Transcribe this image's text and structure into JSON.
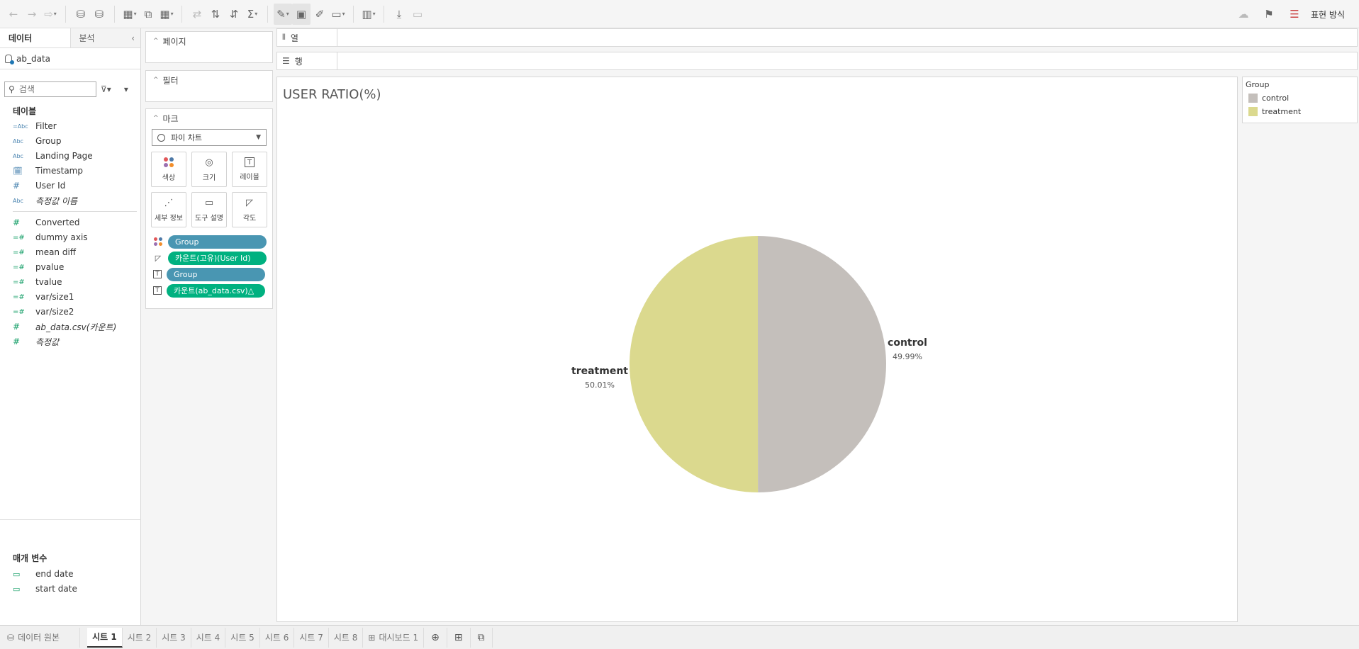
{
  "toolbar": {
    "right_label": "표현 방식"
  },
  "data_pane": {
    "tab_data": "데이터",
    "tab_analysis": "분석",
    "datasource": "ab_data",
    "search_placeholder": "검색",
    "tables_title": "테이블",
    "dimensions": [
      {
        "name": "Filter",
        "type": "abc-calc"
      },
      {
        "name": "Group",
        "type": "abc"
      },
      {
        "name": "Landing Page",
        "type": "abc"
      },
      {
        "name": "Timestamp",
        "type": "datetime"
      },
      {
        "name": "User Id",
        "type": "number"
      },
      {
        "name": "측정값 이름",
        "type": "abc",
        "italic": true
      }
    ],
    "measures": [
      {
        "name": "Converted",
        "type": "number"
      },
      {
        "name": "dummy axis",
        "type": "number-calc"
      },
      {
        "name": "mean diff",
        "type": "number-calc"
      },
      {
        "name": "pvalue",
        "type": "number-calc"
      },
      {
        "name": "tvalue",
        "type": "number-calc"
      },
      {
        "name": "var/size1",
        "type": "number-calc"
      },
      {
        "name": "var/size2",
        "type": "number-calc"
      },
      {
        "name": "ab_data.csv(카운트)",
        "type": "number",
        "italic": true
      },
      {
        "name": "측정값",
        "type": "number",
        "italic": true
      }
    ],
    "params_title": "매개 변수",
    "params": [
      {
        "name": "end date"
      },
      {
        "name": "start date"
      }
    ]
  },
  "cards": {
    "pages": "페이지",
    "filters": "필터",
    "marks": "마크",
    "mark_type": "파이 차트",
    "mark_buttons": [
      {
        "label": "색상",
        "icon": "color-icon"
      },
      {
        "label": "크기",
        "icon": "size-icon"
      },
      {
        "label": "레이블",
        "icon": "label-icon"
      },
      {
        "label": "세부 정보",
        "icon": "detail-icon"
      },
      {
        "label": "도구 설명",
        "icon": "tooltip-icon"
      },
      {
        "label": "각도",
        "icon": "angle-icon"
      }
    ],
    "pills": [
      {
        "label": "Group",
        "kind": "dim",
        "icon": "color-icon"
      },
      {
        "label": "카운트(고유)(User Id)",
        "kind": "meas",
        "icon": "angle-icon"
      },
      {
        "label": "Group",
        "kind": "dim",
        "icon": "label-icon"
      },
      {
        "label": "카운트(ab_data.csv)△",
        "kind": "meas",
        "icon": "label-icon"
      }
    ]
  },
  "shelves": {
    "columns": "열",
    "rows": "행"
  },
  "view": {
    "title": "USER RATIO(%)"
  },
  "chart_data": {
    "type": "pie",
    "title": "USER RATIO(%)",
    "slices": [
      {
        "label": "control",
        "value": 49.99,
        "value_label": "49.99%",
        "color": "#c4bfbb"
      },
      {
        "label": "treatment",
        "value": 50.01,
        "value_label": "50.01%",
        "color": "#dbd98e"
      }
    ],
    "legend_title": "Group",
    "legend_position": "top-right"
  },
  "bottom_tabs": {
    "source": "데이터 원본",
    "sheets": [
      "시트 1",
      "시트 2",
      "시트 3",
      "시트 4",
      "시트 5",
      "시트 6",
      "시트 7",
      "시트 8"
    ],
    "active_index": 0,
    "dashboard": "대시보드 1"
  }
}
